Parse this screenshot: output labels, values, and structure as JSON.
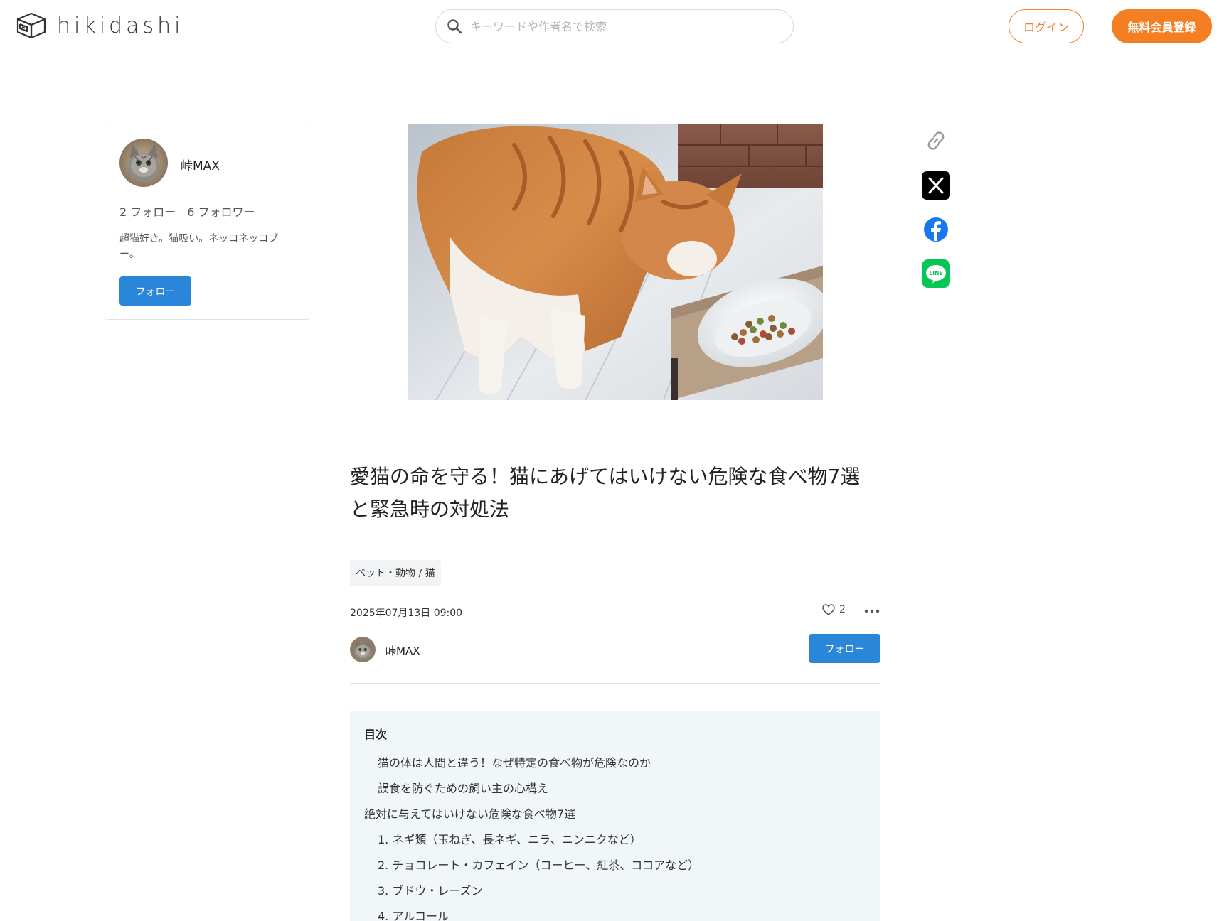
{
  "header": {
    "logo_text": "hikidashi",
    "search_placeholder": "キーワードや作者名で検索",
    "login_label": "ログイン",
    "register_label": "無料会員登録"
  },
  "profile": {
    "name": "峠MAX",
    "following": "2 フォロー",
    "followers": "6 フォロワー",
    "bio": "超猫好き。猫吸い。ネッコネッコブー。",
    "follow_label": "フォロー"
  },
  "share": {
    "icons": [
      "link-icon",
      "x-icon",
      "facebook-icon",
      "line-icon"
    ],
    "line_text": "LINE"
  },
  "article": {
    "title": "愛猫の命を守る！猫にあげてはいけない危険な食べ物7選と緊急時の対処法",
    "tag": "ペット・動物 / 猫",
    "date": "2025年07月13日  09:00",
    "likes": "2",
    "author_name": "峠MAX",
    "follow_label": "フォロー"
  },
  "toc": {
    "title": "目次",
    "items": [
      {
        "label": "猫の体は人間と違う！なぜ特定の食べ物が危険なのか",
        "level": 2
      },
      {
        "label": "誤食を防ぐための飼い主の心構え",
        "level": 2
      },
      {
        "label": "絶対に与えてはいけない危険な食べ物7選",
        "level": 1
      },
      {
        "label": "1. ネギ類（玉ねぎ、長ネギ、ニラ、ニンニクなど）",
        "level": 2
      },
      {
        "label": "2. チョコレート・カフェイン（コーヒー、紅茶、ココアなど）",
        "level": 2
      },
      {
        "label": "3. ブドウ・レーズン",
        "level": 2
      },
      {
        "label": "4. アルコール",
        "level": 2
      }
    ]
  },
  "colors": {
    "accent_orange": "#f47e22",
    "follow_blue": "#2a86d9",
    "toc_bg": "#f1f6f9"
  }
}
